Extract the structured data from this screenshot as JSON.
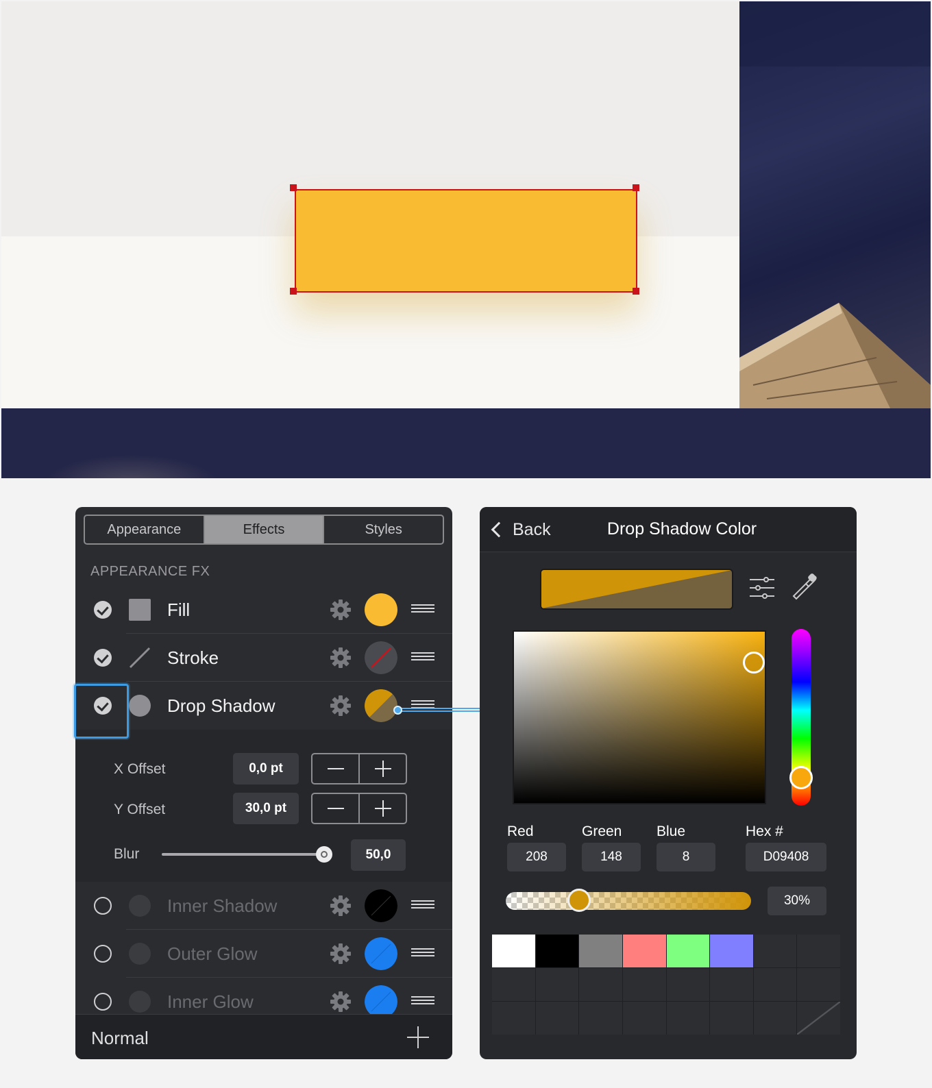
{
  "appearance_panel": {
    "tabs": [
      {
        "label": "Appearance",
        "active": false
      },
      {
        "label": "Effects",
        "active": true
      },
      {
        "label": "Styles",
        "active": false
      }
    ],
    "section_title": "APPEARANCE FX",
    "effects": [
      {
        "label": "Fill",
        "enabled": true,
        "swatch_color": "#f8bb31"
      },
      {
        "label": "Stroke",
        "enabled": true,
        "swatch_color": "none"
      },
      {
        "label": "Drop Shadow",
        "enabled": true,
        "swatch_color": "#d09408",
        "selected": true
      },
      {
        "label": "Inner Shadow",
        "enabled": false,
        "swatch_color": "#000000"
      },
      {
        "label": "Outer Glow",
        "enabled": false,
        "swatch_color": "#1a7ef0"
      },
      {
        "label": "Inner Glow",
        "enabled": false,
        "swatch_color": "#1a7ef0"
      }
    ],
    "drop_shadow": {
      "x_offset_label": "X Offset",
      "x_offset_value": "0,0 pt",
      "y_offset_label": "Y Offset",
      "y_offset_value": "30,0 pt",
      "blur_label": "Blur",
      "blur_value": "50,0",
      "blur_level": 0.98
    },
    "footer": {
      "blend_mode": "Normal"
    }
  },
  "color_panel": {
    "back_label": "Back",
    "title": "Drop Shadow Color",
    "channels": [
      {
        "label": "Red",
        "value": "208"
      },
      {
        "label": "Green",
        "value": "148"
      },
      {
        "label": "Blue",
        "value": "8"
      }
    ],
    "hex_label": "Hex #",
    "hex_value": "D09408",
    "opacity_value": "30%",
    "opacity_level": 0.3,
    "current_color": "#d09408",
    "palette": [
      "#ffffff",
      "#000000",
      "#808080",
      "#ff7f7f",
      "#7fff7f",
      "#7f7fff"
    ]
  },
  "canvas": {
    "shape_fill": "#f8bb31",
    "shape_stroke": "#c8141a"
  },
  "colors": {
    "accent": "#3d9be3",
    "panel_bg": "#2b2c30"
  }
}
